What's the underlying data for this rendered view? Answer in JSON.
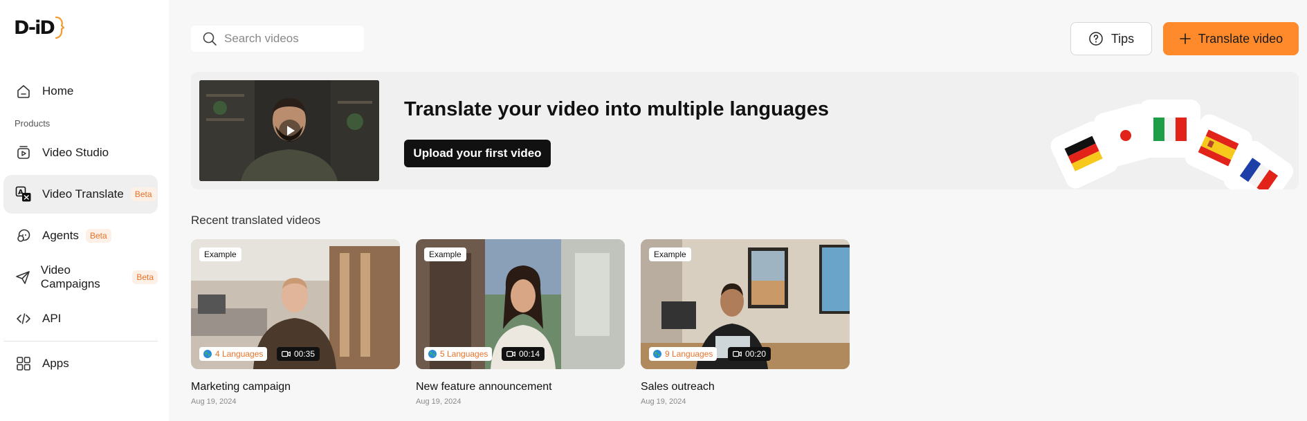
{
  "brand": {
    "logo_text": "D-iD",
    "accent": "#ff8a2b"
  },
  "sidebar": {
    "home": {
      "label": "Home",
      "icon": "home-icon"
    },
    "section_label": "Products",
    "items": [
      {
        "label": "Video Studio",
        "icon": "video-studio-icon",
        "badge": ""
      },
      {
        "label": "Video Translate",
        "icon": "translate-icon",
        "badge": "Beta",
        "active": true
      },
      {
        "label": "Agents",
        "icon": "agents-icon",
        "badge": "Beta"
      },
      {
        "label": "Video Campaigns",
        "icon": "send-icon",
        "badge": "Beta"
      },
      {
        "label": "API",
        "icon": "code-icon",
        "badge": ""
      }
    ],
    "apps": {
      "label": "Apps",
      "icon": "apps-icon"
    }
  },
  "topbar": {
    "search_placeholder": "Search videos",
    "tips_label": "Tips",
    "translate_label": "Translate video"
  },
  "banner": {
    "title": "Translate your video into multiple languages",
    "upload_label": "Upload your first video"
  },
  "recent": {
    "title": "Recent translated videos",
    "cards": [
      {
        "badge": "Example",
        "languages": "4 Languages",
        "duration": "00:35",
        "title": "Marketing campaign",
        "date": "Aug 19, 2024"
      },
      {
        "badge": "Example",
        "languages": "5 Languages",
        "duration": "00:14",
        "title": "New feature announcement",
        "date": "Aug 19, 2024"
      },
      {
        "badge": "Example",
        "languages": "9 Languages",
        "duration": "00:20",
        "title": "Sales outreach",
        "date": "Aug 19, 2024"
      }
    ]
  }
}
